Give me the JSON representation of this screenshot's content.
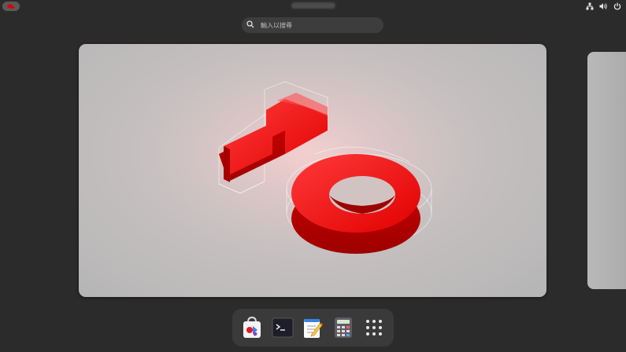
{
  "search": {
    "placeholder": "輸入以搜尋"
  },
  "wallpaper": {
    "text": "10",
    "accent_color": "#e60000"
  },
  "dash": {
    "items": [
      {
        "name": "software-center",
        "icon": "shopping-bag-icon"
      },
      {
        "name": "terminal",
        "icon": "terminal-icon"
      },
      {
        "name": "text-editor",
        "icon": "text-editor-icon"
      },
      {
        "name": "calculator",
        "icon": "calculator-icon"
      },
      {
        "name": "show-apps",
        "icon": "app-grid-icon"
      }
    ]
  }
}
